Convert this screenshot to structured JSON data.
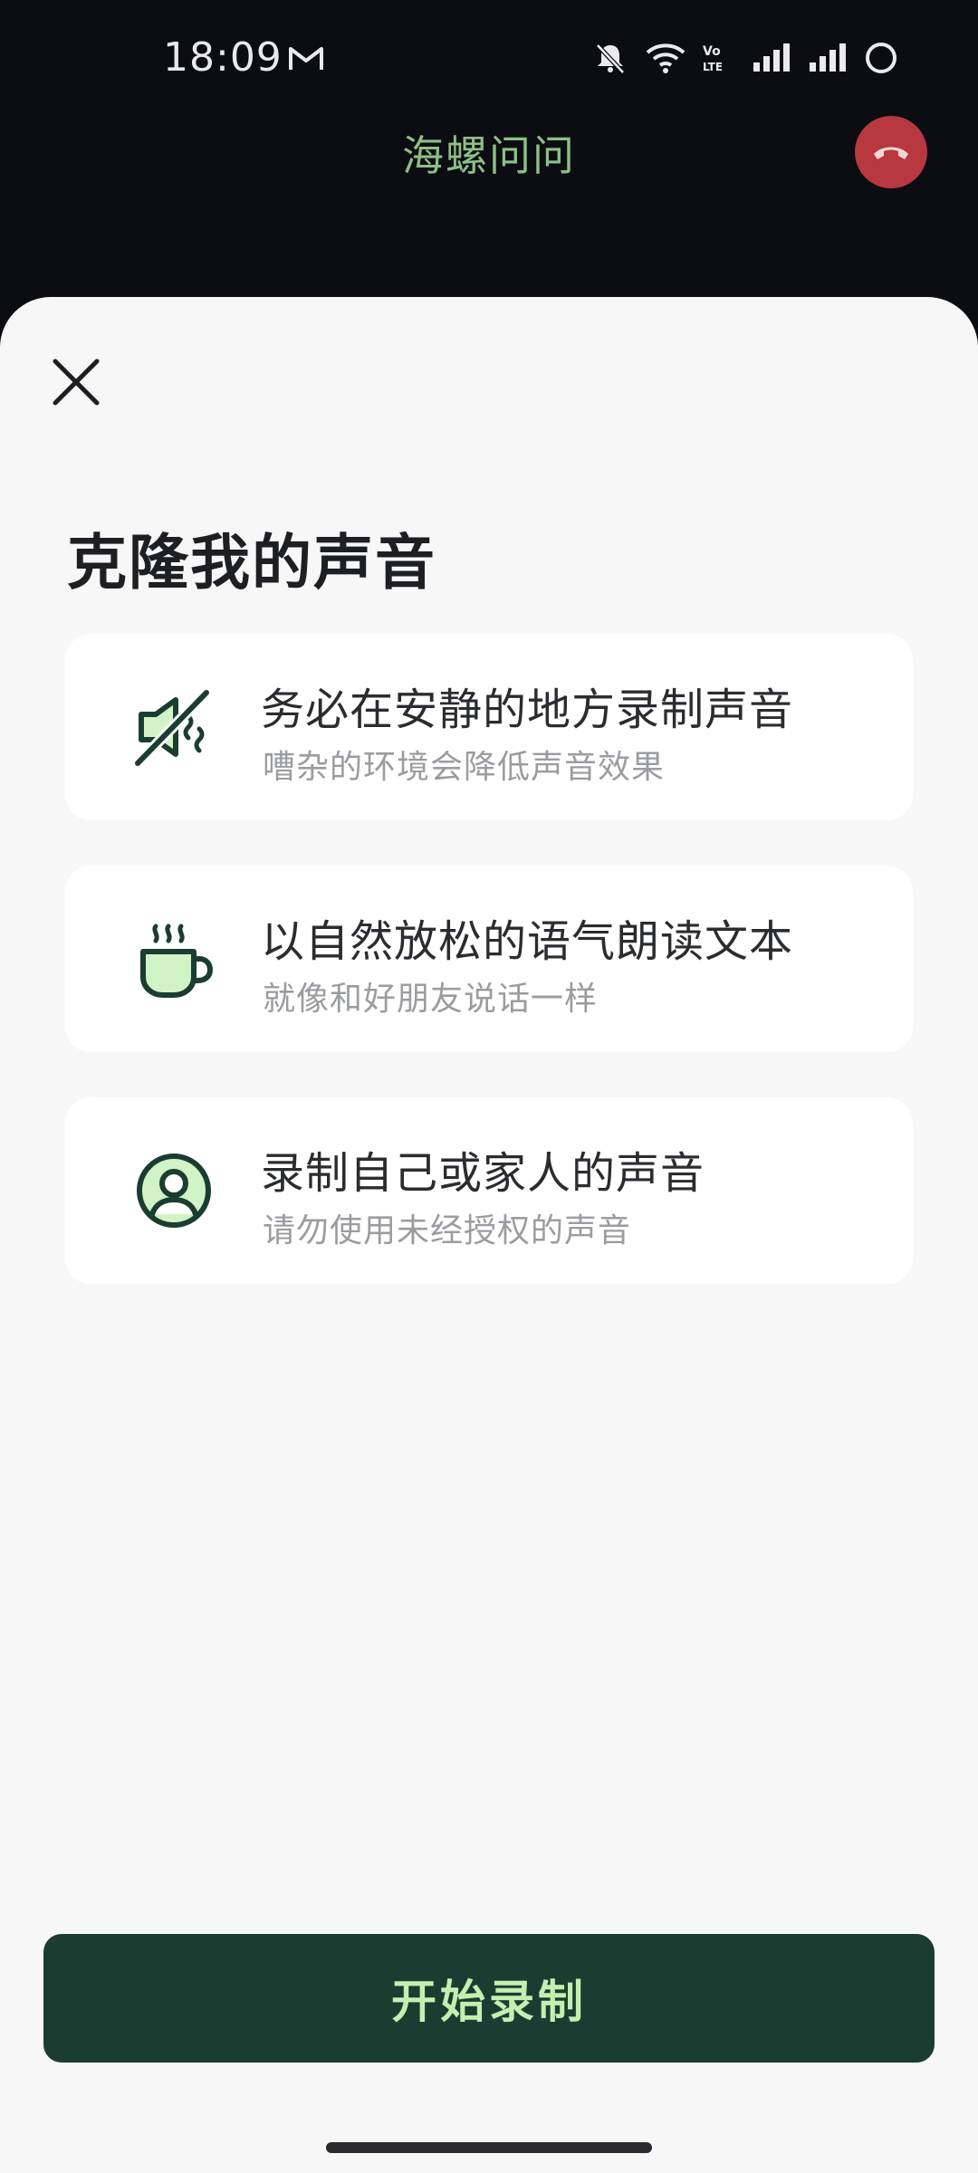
{
  "status_bar": {
    "time": "18:09",
    "icons": [
      "gmail-icon",
      "mute-icon",
      "wifi-icon",
      "volte-icon",
      "signal-icon",
      "signal-icon",
      "battery-icon"
    ],
    "volte_text": "VoLTE"
  },
  "header": {
    "title": "海螺问问",
    "hangup_icon": "phone-hangup-icon"
  },
  "sheet": {
    "close_icon": "close-icon",
    "title": "克隆我的声音",
    "tips": [
      {
        "icon": "mute-speaker-icon",
        "title": "务必在安静的地方录制声音",
        "subtitle": "嘈杂的环境会降低声音效果"
      },
      {
        "icon": "coffee-cup-icon",
        "title": "以自然放松的语气朗读文本",
        "subtitle": "就像和好朋友说话一样"
      },
      {
        "icon": "user-avatar-icon",
        "title": "录制自己或家人的声音",
        "subtitle": "请勿使用未经授权的声音"
      }
    ],
    "start_button_label": "开始录制"
  },
  "colors": {
    "dark_bg": "#0b0d12",
    "sheet_bg": "#f7f7f8",
    "accent_dark_green": "#1b3d31",
    "accent_light_green": "#c5efb1",
    "title_green": "#8dbf86",
    "hangup_red": "#b8383f"
  }
}
